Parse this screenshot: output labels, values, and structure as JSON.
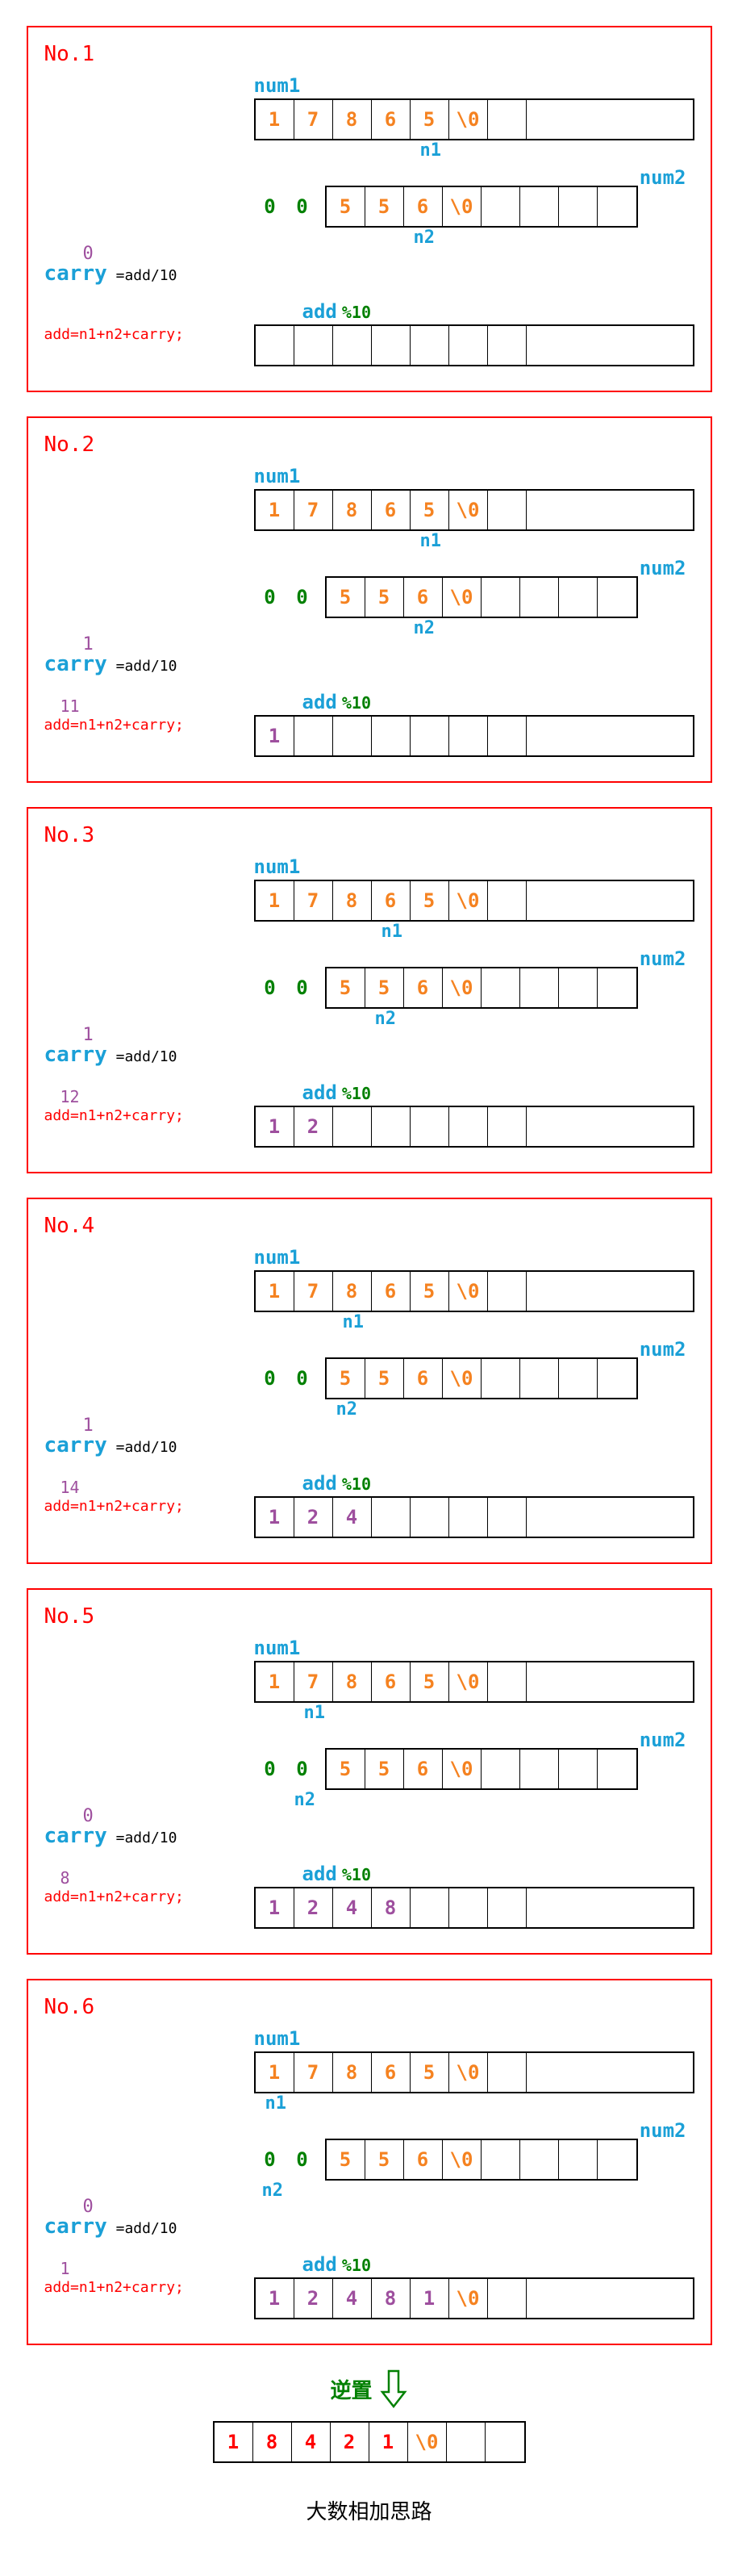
{
  "labels": {
    "num1": "num1",
    "num2": "num2",
    "add": "add",
    "mod": "%10",
    "n1": "n1",
    "n2": "n2",
    "carry": "carry",
    "carry_eq": " =add/10",
    "add_formula": "add=n1+n2+carry;",
    "reverse": "逆置",
    "title": "大数相加思路"
  },
  "num1_full": [
    "1",
    "7",
    "8",
    "6",
    "5",
    "\\0",
    "",
    ""
  ],
  "num2_pad": [
    "0",
    "0"
  ],
  "num2_full": [
    "5",
    "5",
    "6",
    "\\0",
    "",
    "",
    "",
    ""
  ],
  "steps": [
    {
      "no": "No.1",
      "n1_ptr_cell": 4,
      "n2_ptr_cell": 2,
      "carry_val": "0",
      "add_val": "",
      "result": [
        "",
        "",
        "",
        "",
        "",
        "",
        "",
        ""
      ]
    },
    {
      "no": "No.2",
      "n1_ptr_cell": 4,
      "n2_ptr_cell": 2,
      "carry_val": "1",
      "add_val": "11",
      "result": [
        "1",
        "",
        "",
        "",
        "",
        "",
        "",
        ""
      ]
    },
    {
      "no": "No.3",
      "n1_ptr_cell": 3,
      "n2_ptr_cell": 1,
      "carry_val": "1",
      "add_val": "12",
      "result": [
        "1",
        "2",
        "",
        "",
        "",
        "",
        "",
        ""
      ]
    },
    {
      "no": "No.4",
      "n1_ptr_cell": 2,
      "n2_ptr_cell": 0,
      "carry_val": "1",
      "add_val": "14",
      "result": [
        "1",
        "2",
        "4",
        "",
        "",
        "",
        "",
        ""
      ]
    },
    {
      "no": "No.5",
      "n1_ptr_cell": 1,
      "n2_ptr_cell": -1,
      "carry_val": "0",
      "add_val": "8",
      "result": [
        "1",
        "2",
        "4",
        "8",
        "",
        "",
        "",
        ""
      ]
    },
    {
      "no": "No.6",
      "n1_ptr_cell": 0,
      "n2_ptr_cell": -2,
      "carry_val": "0",
      "add_val": "1",
      "result": [
        "1",
        "2",
        "4",
        "8",
        "1",
        "\\0",
        "",
        ""
      ]
    }
  ],
  "final_result": [
    "1",
    "8",
    "4",
    "2",
    "1",
    "\\0",
    "",
    ""
  ]
}
